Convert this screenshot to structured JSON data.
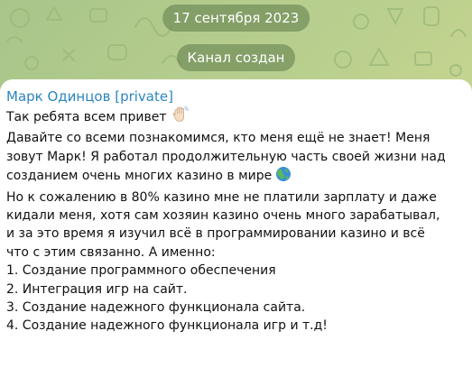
{
  "chat": {
    "date_label": "17 сентября 2023",
    "service_message": "Канал создан"
  },
  "message": {
    "author": "Марк Одинцов [private]",
    "lines": [
      "Так ребята всем привет",
      "Давайте со всеми познакомимся, кто меня ещё не знает! Меня",
      "зовут Марк! Я работал продолжительную часть своей жизни над",
      "созданием очень многих казино в мире",
      "Но к сожалению в 80% казино мне не платили зарплату и даже",
      "кидали меня, хотя сам хозяин казино очень много зарабатывал,",
      "и за это время я изучил всё в программировании казино и всё",
      "что с этим связанно. А именно:",
      "1. Создание программного обеспечения",
      "2. Интеграция игр на сайт.",
      "3. Создание надежного функционала сайта.",
      "4. Создание надежного функционала игр и т.д!"
    ],
    "emojis": {
      "line1": "waving-hand-emoji",
      "line4": "globe-emoji"
    }
  },
  "colors": {
    "author_name": "#2c86c1",
    "message_text": "#111111",
    "pill_background": "#5c7a49",
    "wallpaper": "#b9cf8e"
  }
}
